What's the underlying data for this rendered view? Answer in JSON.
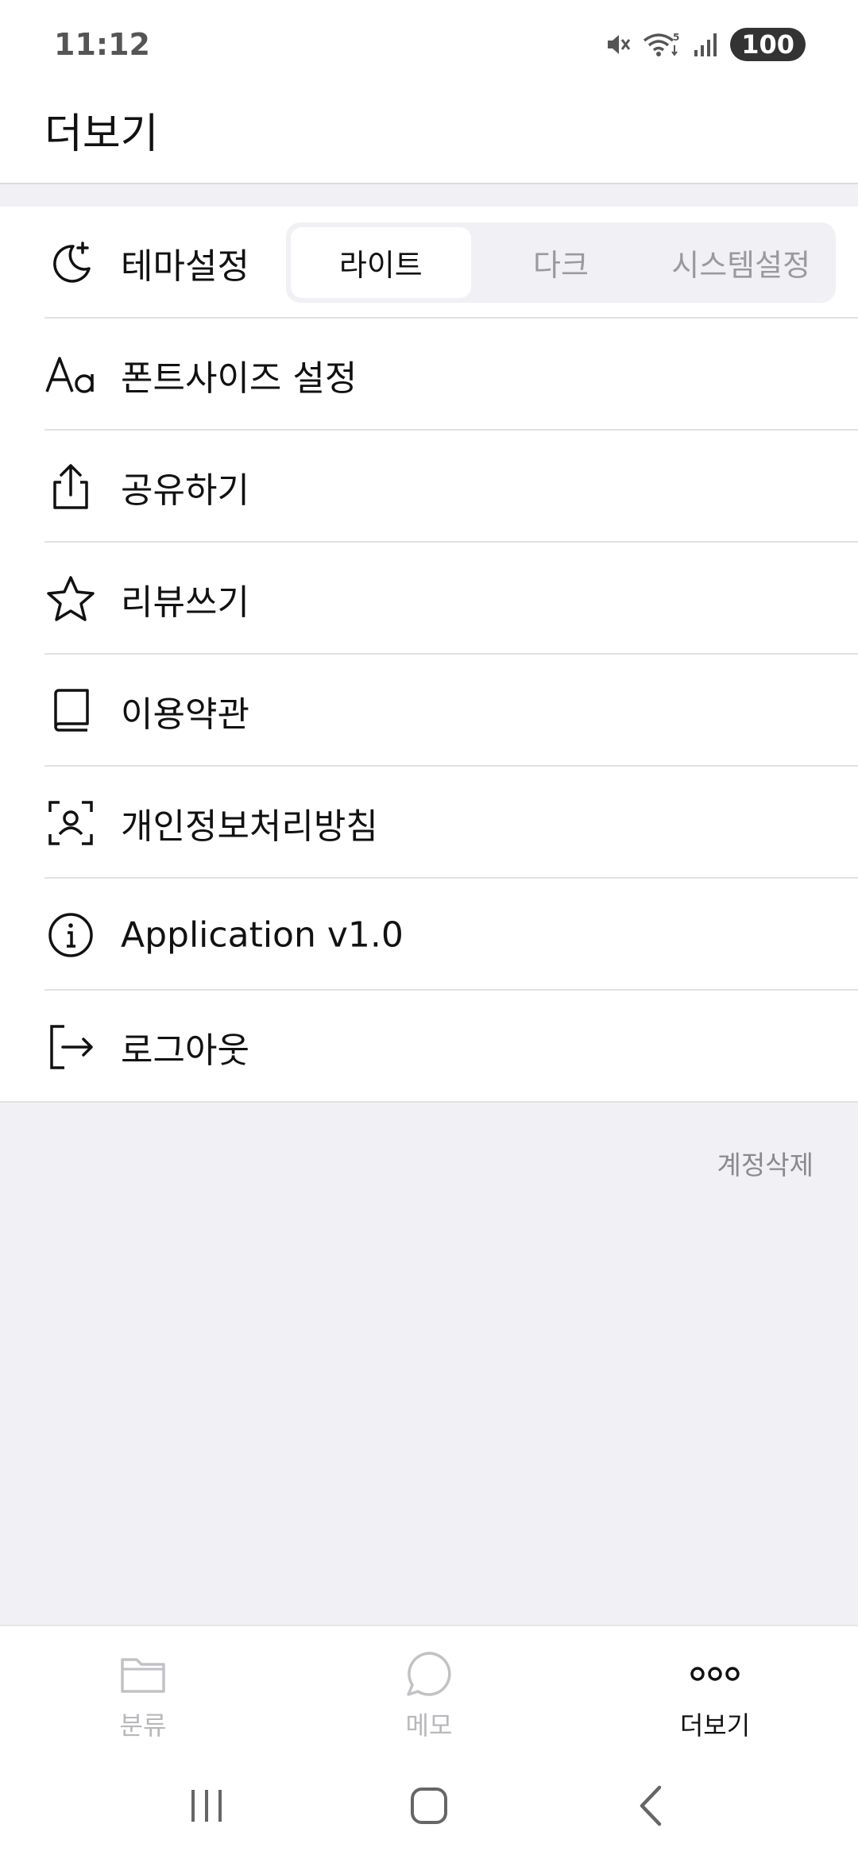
{
  "status_bar": {
    "time": "11:12",
    "battery": "100",
    "icons": [
      "mute-icon",
      "wifi-icon",
      "signal-icon",
      "battery-icon"
    ]
  },
  "header": {
    "title": "더보기"
  },
  "menu": {
    "theme": {
      "label": "테마설정",
      "icon": "moon-star-icon",
      "options": [
        "라이트",
        "다크",
        "시스템설정"
      ],
      "selected": "라이트"
    },
    "items": [
      {
        "label": "폰트사이즈 설정",
        "icon": "font-size-icon"
      },
      {
        "label": "공유하기",
        "icon": "share-icon"
      },
      {
        "label": "리뷰쓰기",
        "icon": "star-icon"
      },
      {
        "label": "이용약관",
        "icon": "book-icon"
      },
      {
        "label": "개인정보처리방침",
        "icon": "person-scan-icon"
      },
      {
        "label": "Application v1.0",
        "icon": "info-icon"
      },
      {
        "label": "로그아웃",
        "icon": "logout-icon"
      }
    ]
  },
  "account": {
    "delete_label": "계정삭제"
  },
  "bottom_nav": {
    "items": [
      {
        "label": "분류",
        "icon": "folder-icon",
        "active": false
      },
      {
        "label": "메모",
        "icon": "chat-bubble-icon",
        "active": false
      },
      {
        "label": "더보기",
        "icon": "more-dots-icon",
        "active": true
      }
    ]
  },
  "colors": {
    "background": "#ffffff",
    "grey_area": "#f0f0f5",
    "text_primary": "#111111",
    "text_inactive": "#b8b8bc",
    "segment_inactive": "#9a9a9e"
  }
}
